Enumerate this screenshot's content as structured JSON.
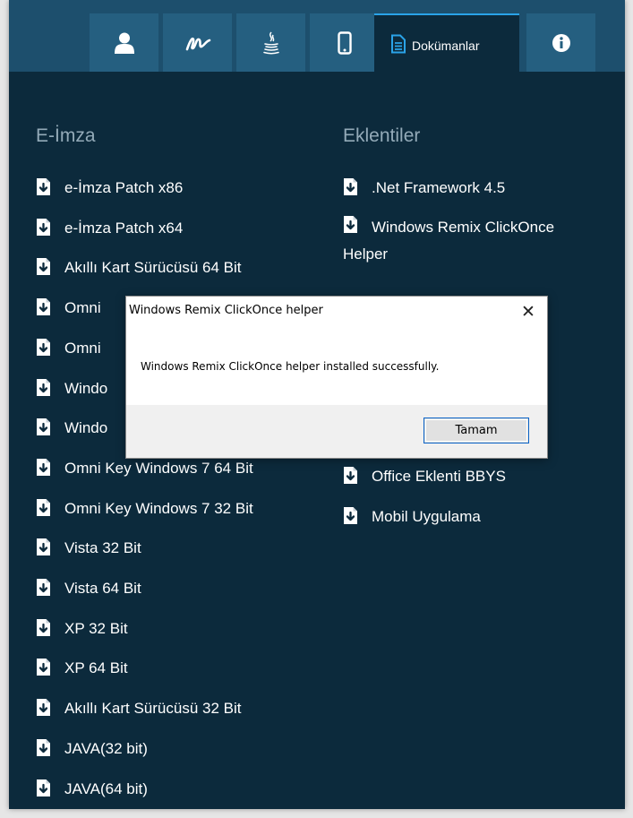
{
  "tabs": [
    {
      "icon": "user-icon",
      "label": ""
    },
    {
      "icon": "signature-icon",
      "label": ""
    },
    {
      "icon": "java-icon",
      "label": ""
    },
    {
      "icon": "mobile-icon",
      "label": ""
    },
    {
      "icon": "document-icon",
      "label": "Dokümanlar",
      "active": true
    },
    {
      "icon": "info-icon",
      "label": ""
    }
  ],
  "left_column": {
    "title": "E-İmza",
    "items": [
      "e-İmza Patch x86",
      "e-İmza Patch x64",
      "Akıllı Kart Sürücüsü 64 Bit",
      "Omni",
      "Omni",
      "Windo",
      "Windo",
      "Omni Key Windows 7 64 Bit",
      "Omni Key Windows 7 32 Bit",
      "Vista 32 Bit",
      "Vista 64 Bit",
      "XP 32 Bit",
      "XP 64 Bit",
      "Akıllı Kart Sürücüsü 32 Bit",
      "JAVA(32 bit)",
      "JAVA(64 bit)"
    ]
  },
  "right_column": {
    "title": "Eklentiler",
    "items": [
      ".Net Framework 4.5",
      "Windows Remix ClickOnce Helper",
      "Office Eklenti BBYS",
      "Mobil Uygulama"
    ]
  },
  "dialog": {
    "title": "Windows Remix ClickOnce helper",
    "close": "✕",
    "message": "Windows Remix ClickOnce helper installed successfully.",
    "ok_label": "Tamam"
  },
  "colors": {
    "panel_bg": "#0c2a3c",
    "tabbar_bg": "#1d4f6d",
    "tab_bg": "#255f80",
    "accent": "#2aa3e8",
    "heading": "#93aab8"
  }
}
